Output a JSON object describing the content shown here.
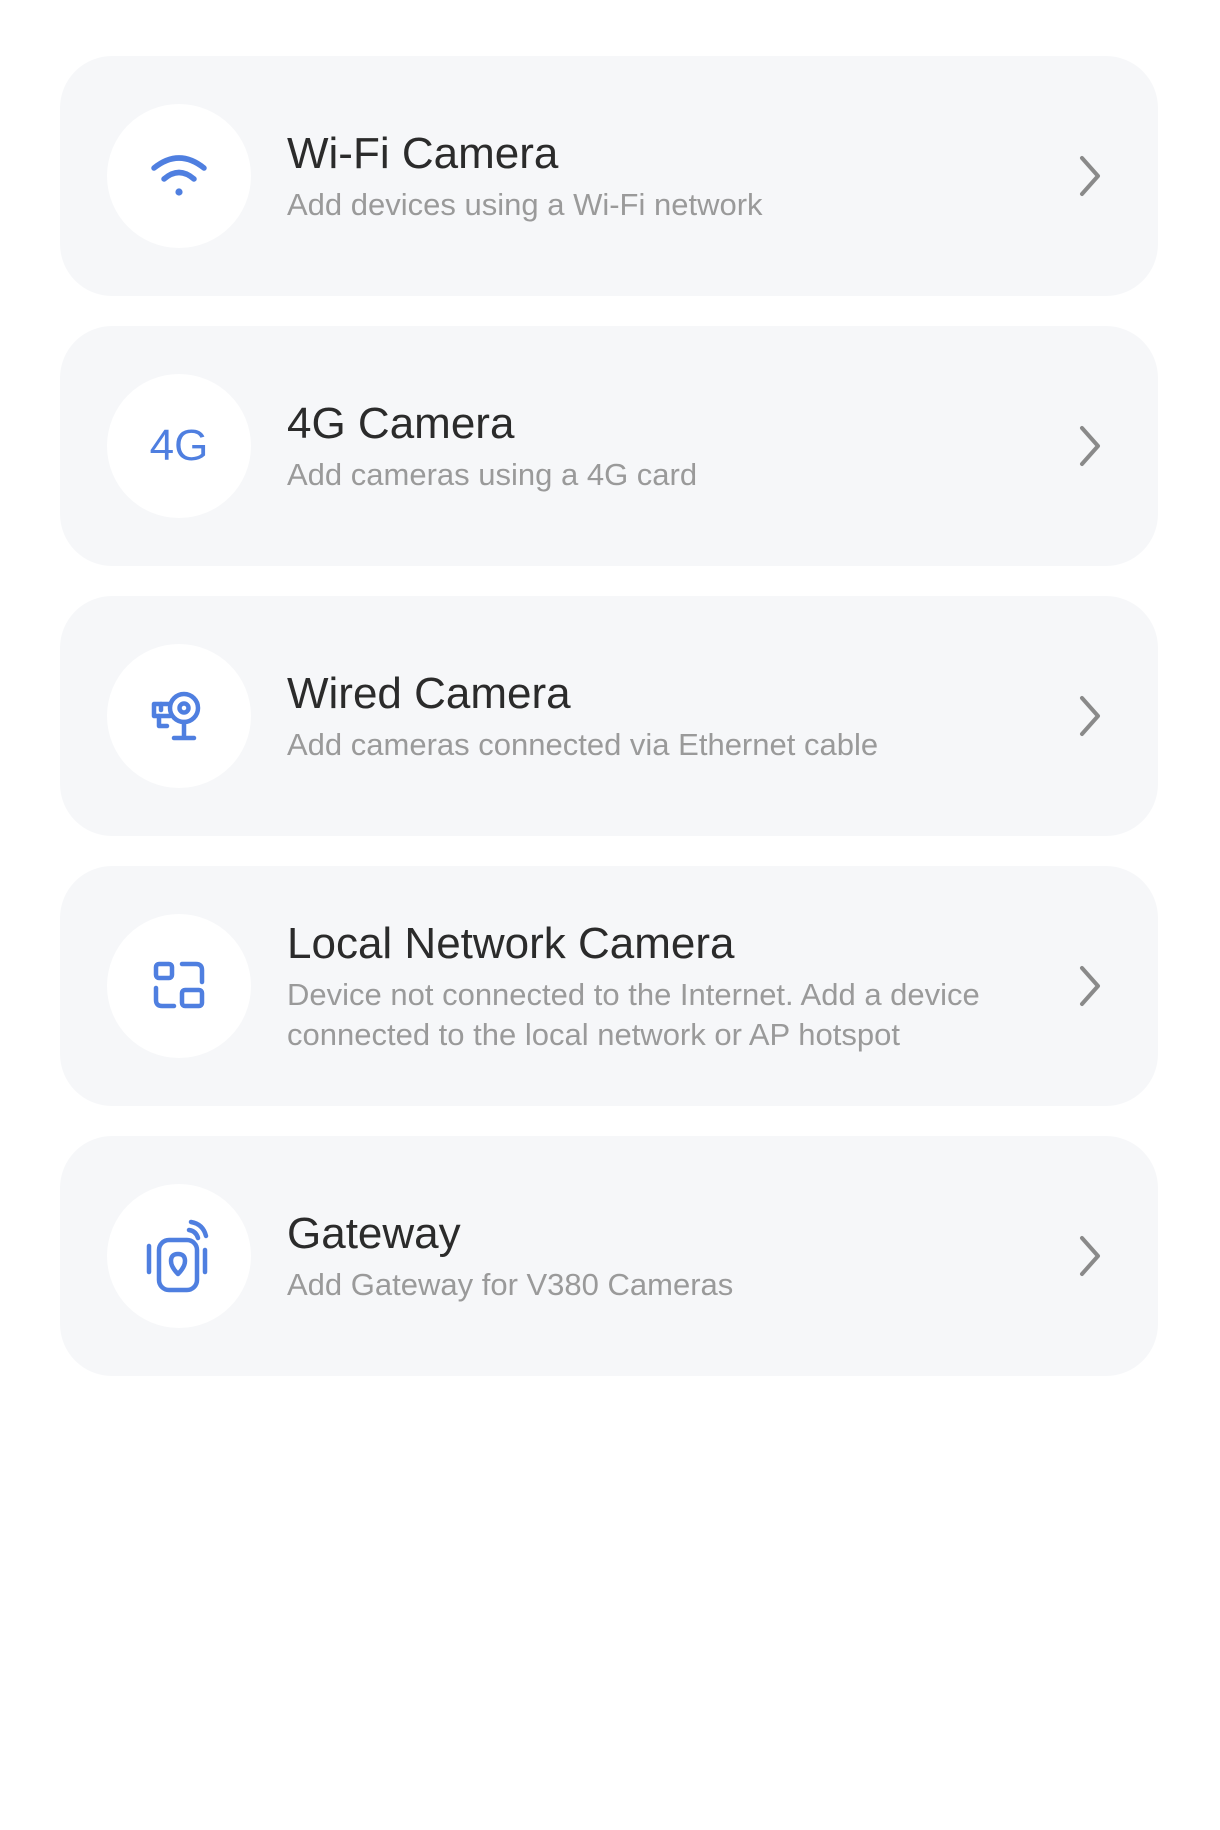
{
  "items": [
    {
      "title": "Wi-Fi Camera",
      "subtitle": "Add devices using a Wi-Fi network",
      "icon": "wifi-icon"
    },
    {
      "title": "4G Camera",
      "subtitle": "Add cameras using a 4G card",
      "icon": "4g-icon",
      "icon_text": "4G"
    },
    {
      "title": "Wired Camera",
      "subtitle": "Add cameras connected via Ethernet cable",
      "icon": "wired-camera-icon"
    },
    {
      "title": "Local Network Camera",
      "subtitle": "Device not connected to the Internet. Add a device connected to the local network or AP hotspot",
      "icon": "local-network-icon"
    },
    {
      "title": "Gateway",
      "subtitle": "Add Gateway for V380 Cameras",
      "icon": "gateway-icon"
    }
  ],
  "colors": {
    "accent": "#4f7fe0",
    "card_background": "#f6f7f9",
    "title": "#2b2b2b",
    "subtitle": "#9a9a9a",
    "chevron": "#8a8a8a"
  }
}
